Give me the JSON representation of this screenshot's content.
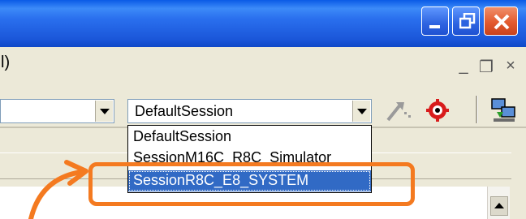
{
  "menubar": {
    "partial_menu": "l)"
  },
  "mdi_controls": {
    "minimize": "_",
    "restore": "❐",
    "close": "×"
  },
  "toolbar": {
    "session_combo_value": "DefaultSession"
  },
  "session_dropdown": {
    "items": [
      {
        "label": "DefaultSession",
        "selected": false
      },
      {
        "label": "SessionM16C_R8C_Simulator",
        "selected": false
      },
      {
        "label": "SessionR8C_E8_SYSTEM",
        "selected": true
      }
    ]
  },
  "annotation": {
    "color": "#f47a20"
  },
  "colors": {
    "selection": "#316ac5",
    "titlebar": "#2a6fee",
    "chrome": "#ece9d8"
  }
}
